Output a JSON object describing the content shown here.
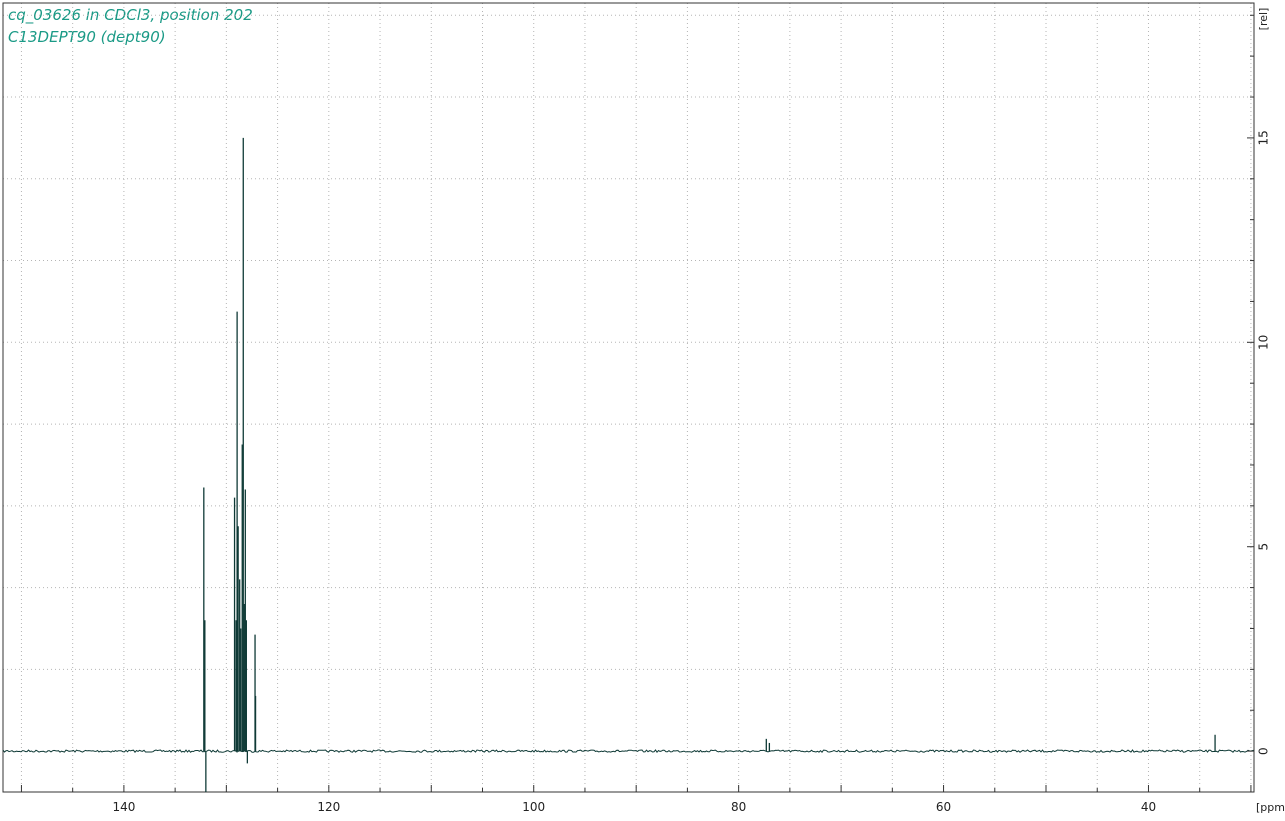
{
  "header": {
    "line1": "cq_03626 in CDCl3, position 202",
    "line2": "C13DEPT90 (dept90)"
  },
  "colors": {
    "title": "#1a9a86",
    "spectrum": "#0f3a36",
    "grid": "#b5b5b5",
    "axis": "#333333"
  },
  "chart_data": {
    "type": "line",
    "title": "",
    "xlabel": "[ppm]",
    "ylabel": "[rel]",
    "xlim": [
      151.8,
      29.7
    ],
    "ylim": [
      -1.0,
      18.3
    ],
    "x_ticks": [
      140,
      120,
      100,
      80,
      60,
      40
    ],
    "x_tick_labels": [
      "140",
      "120",
      "100",
      "80",
      "60",
      "40"
    ],
    "y_ticks": [
      0,
      5,
      10,
      15
    ],
    "y_tick_labels": [
      "0",
      "5",
      "10",
      "15"
    ],
    "grid": true,
    "baseline": 0,
    "series": [
      {
        "peaks": [
          {
            "ppm": 132.2,
            "height": 6.45
          },
          {
            "ppm": 132.1,
            "height": 3.2
          },
          {
            "ppm": 132.0,
            "height": -1.0
          },
          {
            "ppm": 129.2,
            "height": 6.2
          },
          {
            "ppm": 129.05,
            "height": 3.2
          },
          {
            "ppm": 128.95,
            "height": 10.75
          },
          {
            "ppm": 128.85,
            "height": 5.5
          },
          {
            "ppm": 128.7,
            "height": 4.2
          },
          {
            "ppm": 128.6,
            "height": 3.0
          },
          {
            "ppm": 128.45,
            "height": 7.5
          },
          {
            "ppm": 128.35,
            "height": 15.0
          },
          {
            "ppm": 128.25,
            "height": 3.6
          },
          {
            "ppm": 128.15,
            "height": 6.4
          },
          {
            "ppm": 128.05,
            "height": 3.2
          },
          {
            "ppm": 127.95,
            "height": -0.3
          },
          {
            "ppm": 127.2,
            "height": 2.85
          },
          {
            "ppm": 127.15,
            "height": 1.35
          },
          {
            "ppm": 77.3,
            "height": 0.3
          },
          {
            "ppm": 77.0,
            "height": 0.2
          },
          {
            "ppm": 33.5,
            "height": 0.4
          }
        ]
      }
    ]
  }
}
